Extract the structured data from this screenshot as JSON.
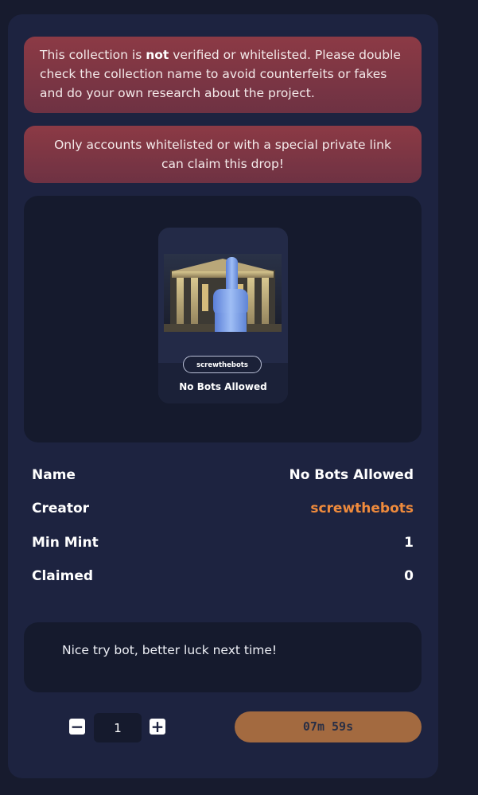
{
  "warnings": {
    "collection_prefix": "This collection is ",
    "collection_emphasis": "not",
    "collection_suffix": " verified or whitelisted. Please double check the collection name to avoid counterfeits or fakes and do your own research about the project.",
    "whitelist": "Only accounts whitelisted or with a special private link can claim this drop!"
  },
  "nft_card": {
    "collection": "screwthebots",
    "name": "No Bots Allowed"
  },
  "details": {
    "name_label": "Name",
    "name_value": "No Bots Allowed",
    "creator_label": "Creator",
    "creator_value": "screwthebots",
    "min_mint_label": "Min Mint",
    "min_mint_value": "1",
    "claimed_label": "Claimed",
    "claimed_value": "0"
  },
  "message": "Nice try bot, better luck next time!",
  "claim": {
    "quantity": "1",
    "countdown": "07m 59s",
    "decrement_symbol": "−",
    "increment_symbol": "+"
  },
  "colors": {
    "page_bg": "#171b2e",
    "panel_bg": "#1d2340",
    "alert_bg": "#8c3a45",
    "creator_accent": "#ee8a3c",
    "timer_button_bg": "#a36a40"
  }
}
